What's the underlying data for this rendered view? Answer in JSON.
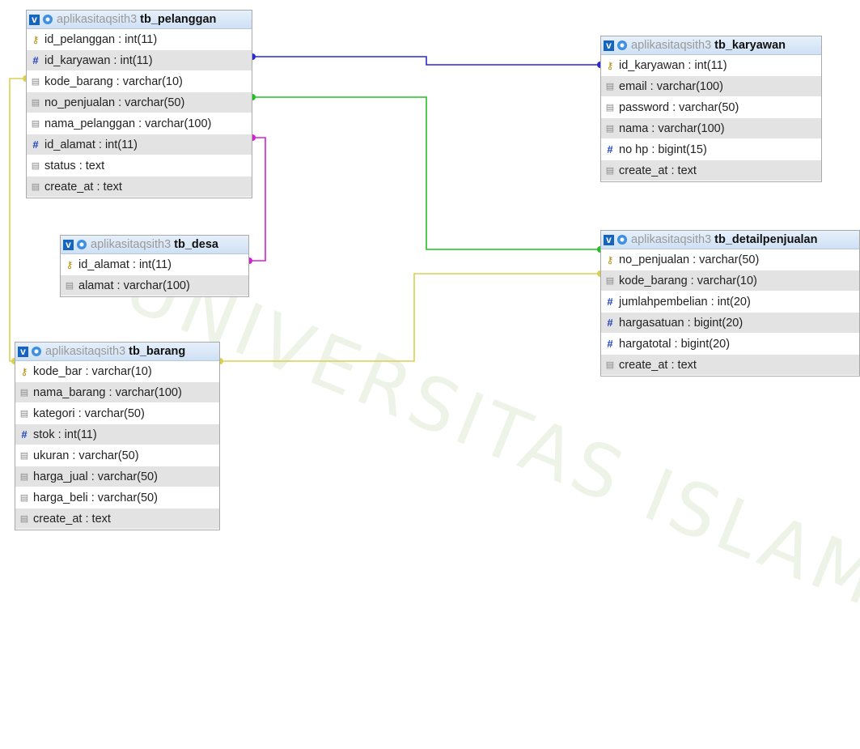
{
  "tables": {
    "tb_pelanggan": {
      "db": "aplikasitaqsith3",
      "name": "tb_pelanggan",
      "fields": [
        {
          "icon": "key",
          "text": "id_pelanggan : int(11)"
        },
        {
          "icon": "num",
          "text": "id_karyawan : int(11)"
        },
        {
          "icon": "txt",
          "text": "kode_barang : varchar(10)"
        },
        {
          "icon": "txt",
          "text": "no_penjualan : varchar(50)"
        },
        {
          "icon": "txt",
          "text": "nama_pelanggan : varchar(100)"
        },
        {
          "icon": "num",
          "text": "id_alamat : int(11)"
        },
        {
          "icon": "txt",
          "text": "status : text"
        },
        {
          "icon": "txt",
          "text": "create_at : text"
        }
      ]
    },
    "tb_karyawan": {
      "db": "aplikasitaqsith3",
      "name": "tb_karyawan",
      "fields": [
        {
          "icon": "key",
          "text": "id_karyawan : int(11)"
        },
        {
          "icon": "txt",
          "text": "email : varchar(100)"
        },
        {
          "icon": "txt",
          "text": "password : varchar(50)"
        },
        {
          "icon": "txt",
          "text": "nama : varchar(100)"
        },
        {
          "icon": "num",
          "text": "no hp : bigint(15)"
        },
        {
          "icon": "txt",
          "text": "create_at : text"
        }
      ]
    },
    "tb_desa": {
      "db": "aplikasitaqsith3",
      "name": "tb_desa",
      "fields": [
        {
          "icon": "key",
          "text": "id_alamat : int(11)"
        },
        {
          "icon": "txt",
          "text": "alamat : varchar(100)"
        }
      ]
    },
    "tb_detailpenjualan": {
      "db": "aplikasitaqsith3",
      "name": "tb_detailpenjualan",
      "fields": [
        {
          "icon": "key",
          "text": "no_penjualan : varchar(50)"
        },
        {
          "icon": "txt",
          "text": "kode_barang : varchar(10)"
        },
        {
          "icon": "num",
          "text": "jumlahpembelian : int(20)"
        },
        {
          "icon": "num",
          "text": "hargasatuan : bigint(20)"
        },
        {
          "icon": "num",
          "text": "hargatotal : bigint(20)"
        },
        {
          "icon": "txt",
          "text": "create_at : text"
        }
      ]
    },
    "tb_barang": {
      "db": "aplikasitaqsith3",
      "name": "tb_barang",
      "fields": [
        {
          "icon": "key",
          "text": "kode_bar : varchar(10)"
        },
        {
          "icon": "txt",
          "text": "nama_barang : varchar(100)"
        },
        {
          "icon": "txt",
          "text": "kategori : varchar(50)"
        },
        {
          "icon": "num",
          "text": "stok : int(11)"
        },
        {
          "icon": "txt",
          "text": "ukuran : varchar(50)"
        },
        {
          "icon": "txt",
          "text": "harga_jual : varchar(50)"
        },
        {
          "icon": "txt",
          "text": "harga_beli : varchar(50)"
        },
        {
          "icon": "txt",
          "text": "create_at : text"
        }
      ]
    }
  },
  "relations": [
    {
      "from": "tb_pelanggan.id_karyawan",
      "to": "tb_karyawan.id_karyawan",
      "color": "#2a2ad0"
    },
    {
      "from": "tb_pelanggan.no_penjualan",
      "to": "tb_detailpenjualan.no_penjualan",
      "color": "#22c022"
    },
    {
      "from": "tb_pelanggan.id_alamat",
      "to": "tb_desa.id_alamat",
      "color": "#d020d0"
    },
    {
      "from": "tb_pelanggan.kode_barang",
      "to": "tb_barang.kode_bar",
      "color": "#d8d050"
    },
    {
      "from": "tb_barang.kode_bar",
      "to": "tb_detailpenjualan.kode_barang",
      "color": "#d8d050"
    }
  ],
  "watermark": "UNIVERSITAS ISLAM NEGERI MAULANA MALIK IBRAHIM"
}
